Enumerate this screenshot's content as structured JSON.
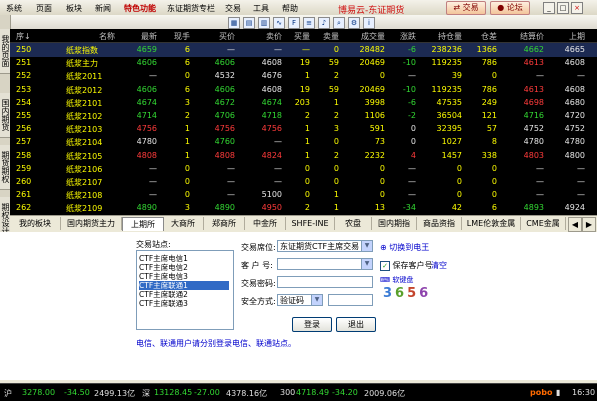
{
  "menubar": {
    "items": [
      "系统",
      "页面",
      "板块",
      "新闻",
      "特色功能",
      "东证期货专栏",
      "交易",
      "工具",
      "帮助"
    ],
    "title": "博易云-东证期货",
    "trade_label": "交易",
    "forum_label": "论坛"
  },
  "sidebar": {
    "tabs": [
      "我的页面",
      "国内期货",
      "期货期权",
      "期权设计"
    ]
  },
  "grid": {
    "headers": [
      "序↓",
      "名称",
      "最新",
      "现手",
      "买价",
      "卖价",
      "买量",
      "卖量",
      "成交量",
      "涨跌",
      "持仓量",
      "仓差",
      "结算价",
      "上期"
    ],
    "rows": [
      {
        "seq": "250",
        "name": "纸浆指数",
        "last": "4659",
        "hand": "6",
        "bid": "—",
        "ask": "—",
        "bidv": "—",
        "askv": "0",
        "vol": "28482",
        "chg": "-6",
        "oi": "238236",
        "oid": "1366",
        "settle": "4662",
        "prev": "4665",
        "sel": true
      },
      {
        "seq": "251",
        "name": "纸浆主力",
        "last": "4606",
        "hand": "6",
        "bid": "4606",
        "ask": "4608",
        "bidv": "19",
        "askv": "59",
        "vol": "20469",
        "chg": "-10",
        "oi": "119235",
        "oid": "786",
        "settle": "4613",
        "prev": "4608"
      },
      {
        "seq": "252",
        "name": "纸浆2011",
        "last": "—",
        "hand": "0",
        "bid": "4532",
        "ask": "4676",
        "bidv": "1",
        "askv": "2",
        "vol": "0",
        "chg": "—",
        "oi": "39",
        "oid": "0",
        "settle": "—",
        "prev": "—"
      },
      {
        "seq": "253",
        "name": "纸浆2012",
        "last": "4606",
        "hand": "6",
        "bid": "4606",
        "ask": "4608",
        "bidv": "19",
        "askv": "59",
        "vol": "20469",
        "chg": "-10",
        "oi": "119235",
        "oid": "786",
        "settle": "4613",
        "prev": "4608"
      },
      {
        "seq": "254",
        "name": "纸浆2101",
        "last": "4674",
        "hand": "3",
        "bid": "4672",
        "ask": "4674",
        "bidv": "203",
        "askv": "1",
        "vol": "3998",
        "chg": "-6",
        "oi": "47535",
        "oid": "249",
        "settle": "4698",
        "prev": "4680"
      },
      {
        "seq": "255",
        "name": "纸浆2102",
        "last": "4714",
        "hand": "2",
        "bid": "4706",
        "ask": "4718",
        "bidv": "2",
        "askv": "2",
        "vol": "1106",
        "chg": "-2",
        "oi": "36504",
        "oid": "121",
        "settle": "4716",
        "prev": "4720"
      },
      {
        "seq": "256",
        "name": "纸浆2103",
        "last": "4756",
        "hand": "1",
        "bid": "4756",
        "ask": "4756",
        "bidv": "1",
        "askv": "3",
        "vol": "591",
        "chg": "0",
        "oi": "32395",
        "oid": "57",
        "settle": "4752",
        "prev": "4752"
      },
      {
        "seq": "257",
        "name": "纸浆2104",
        "last": "4780",
        "hand": "1",
        "bid": "4760",
        "ask": "—",
        "bidv": "1",
        "askv": "0",
        "vol": "73",
        "chg": "0",
        "oi": "1027",
        "oid": "8",
        "settle": "4780",
        "prev": "4780"
      },
      {
        "seq": "258",
        "name": "纸浆2105",
        "last": "4808",
        "hand": "1",
        "bid": "4808",
        "ask": "4824",
        "bidv": "1",
        "askv": "2",
        "vol": "2232",
        "chg": "4",
        "oi": "1457",
        "oid": "338",
        "settle": "4803",
        "prev": "4800"
      },
      {
        "seq": "259",
        "name": "纸浆2106",
        "last": "—",
        "hand": "0",
        "bid": "—",
        "ask": "—",
        "bidv": "0",
        "askv": "0",
        "vol": "0",
        "chg": "—",
        "oi": "0",
        "oid": "0",
        "settle": "—",
        "prev": "—"
      },
      {
        "seq": "260",
        "name": "纸浆2107",
        "last": "—",
        "hand": "0",
        "bid": "—",
        "ask": "—",
        "bidv": "0",
        "askv": "0",
        "vol": "0",
        "chg": "—",
        "oi": "0",
        "oid": "0",
        "settle": "—",
        "prev": "—"
      },
      {
        "seq": "261",
        "name": "纸浆2108",
        "last": "—",
        "hand": "0",
        "bid": "—",
        "ask": "5100",
        "bidv": "0",
        "askv": "1",
        "vol": "0",
        "chg": "—",
        "oi": "0",
        "oid": "0",
        "settle": "—",
        "prev": "—"
      },
      {
        "seq": "262",
        "name": "纸浆2109",
        "last": "4890",
        "hand": "3",
        "bid": "4890",
        "ask": "4950",
        "bidv": "2",
        "askv": "1",
        "vol": "13",
        "chg": "-34",
        "oi": "42",
        "oid": "6",
        "settle": "4893",
        "prev": "4924"
      }
    ]
  },
  "tabs": [
    "我的板块",
    "国内期货主力",
    "上期所",
    "大商所",
    "郑商所",
    "中金所",
    "SHFE-INE",
    "农盘",
    "国内期指",
    "商品资指",
    "LME伦敦金属",
    "CME金属"
  ],
  "login": {
    "station_label": "交易站点:",
    "stations": [
      "CTF主席电信1",
      "CTF主席电信2",
      "CTF主席电信3",
      "CTF主席联通1",
      "CTF主席联通2",
      "CTF主席联通3"
    ],
    "venue_label": "交易席位:",
    "venue_value": "东证期货CTF主席交易",
    "switch_link": "切换到电王",
    "account_label": "客 户 号:",
    "save_account_label": "保存客户号",
    "clear_link": "清空",
    "password_label": "交易密码:",
    "keyboard_label": "软键盘",
    "security_label": "安全方式:",
    "security_value": "验证码",
    "captcha": [
      "3",
      "6",
      "5",
      "6"
    ],
    "login_button": "登录",
    "exit_button": "退出",
    "notice": "电信、联通用户请分别登录电信、联通站点。"
  },
  "statusbar": {
    "index1": "沪",
    "val1": "3278.00",
    "chg1": "-34.50",
    "amt1": "2499.13亿",
    "index2": "深",
    "val2": "13128.45",
    "chg2": "-27.00",
    "amt2": "4378.16亿",
    "index3": "300",
    "val3": "4718.49",
    "chg3": "-34.20",
    "amt3": "2009.06亿",
    "brand": "pobo",
    "time": "16:30"
  },
  "colors": {
    "up": "#ff3b3b",
    "down": "#33d933",
    "highlight": "#ffff00",
    "selection": "#316ac5"
  }
}
